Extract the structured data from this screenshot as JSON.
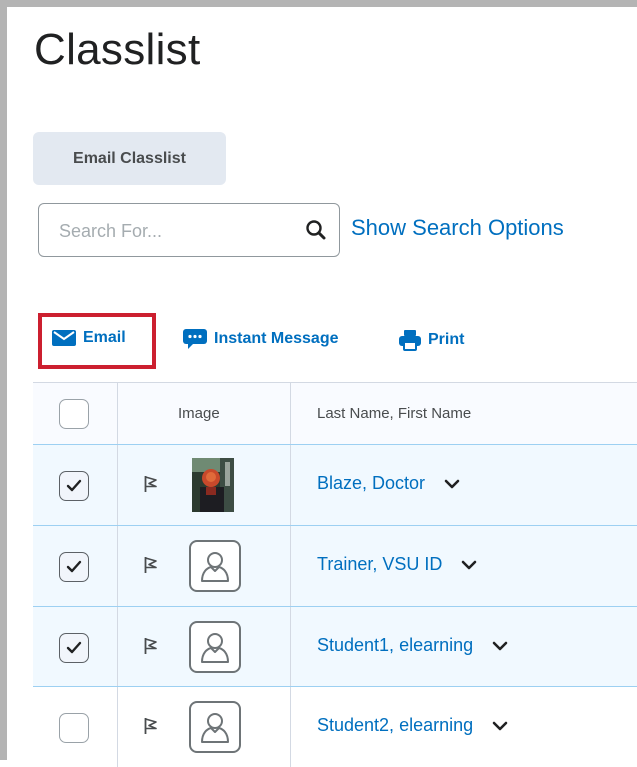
{
  "page": {
    "title": "Classlist"
  },
  "toolbar": {
    "email_classlist_label": "Email Classlist"
  },
  "search": {
    "placeholder": "Search For...",
    "value": "",
    "options_link": "Show Search Options"
  },
  "actions": {
    "email": "Email",
    "instant_message": "Instant Message",
    "print": "Print"
  },
  "table": {
    "columns": {
      "select": "",
      "image": "Image",
      "name": "Last Name, First Name"
    },
    "rows": [
      {
        "name": "Blaze, Doctor",
        "checked": true,
        "avatar": "photo"
      },
      {
        "name": "Trainer, VSU ID",
        "checked": true,
        "avatar": "default-user-icon"
      },
      {
        "name": "Student1, elearning",
        "checked": true,
        "avatar": "default-user-icon"
      },
      {
        "name": "Student2, elearning",
        "checked": false,
        "avatar": "default-user-icon"
      }
    ]
  },
  "colors": {
    "link": "#006fbf",
    "highlight": "#cc1f2f",
    "selected_row": "#f1f9ff"
  }
}
